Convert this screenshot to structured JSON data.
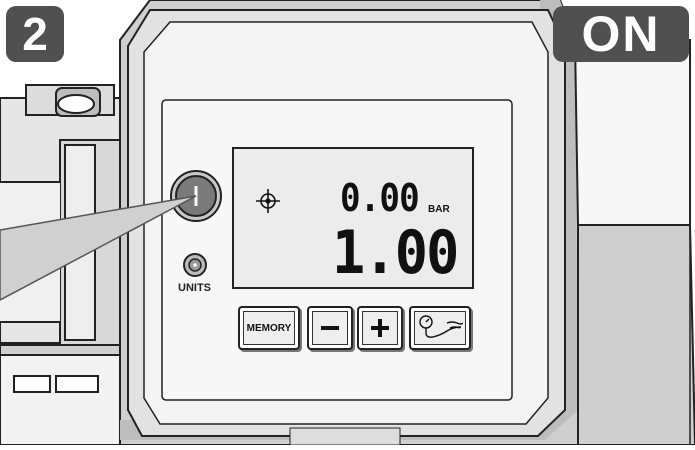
{
  "step_badge": "2",
  "status_badge": "ON",
  "display": {
    "upper_value": "0.00",
    "upper_unit": "BAR",
    "lower_value": "1.00",
    "target_icon": "crosshair-icon"
  },
  "buttons": {
    "memory_label": "MEMORY",
    "minus_icon": "minus-icon",
    "plus_icon": "plus-icon",
    "gauge_icon": "gauge-hose-icon"
  },
  "units_label": "UNITS",
  "power_button_icon": "power-icon",
  "colors": {
    "badge_bg": "#505050",
    "badge_text": "#ffffff",
    "housing": "#d6d6d6",
    "lcd": "#ececec"
  }
}
